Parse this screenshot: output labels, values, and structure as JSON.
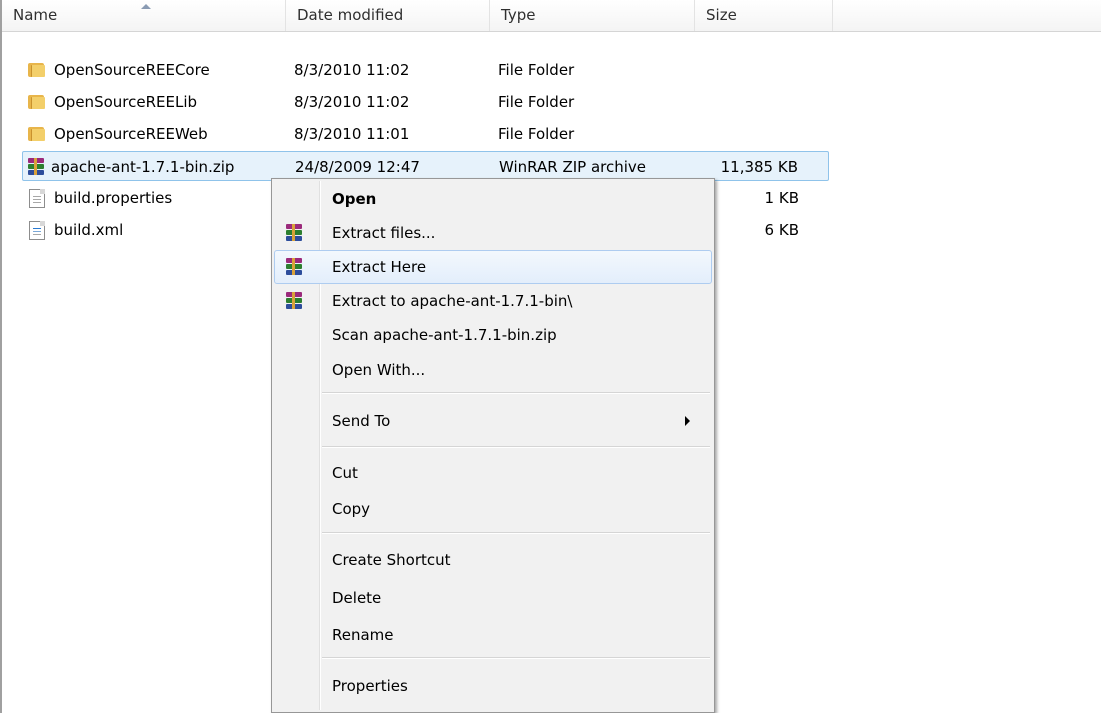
{
  "header": {
    "columns": [
      "Name",
      "Date modified",
      "Type",
      "Size"
    ]
  },
  "files": [
    {
      "name": "OpenSourceREECore",
      "date": "8/3/2010 11:02",
      "type": "File Folder",
      "size": "",
      "icon": "folder-icon"
    },
    {
      "name": "OpenSourceREELib",
      "date": "8/3/2010 11:02",
      "type": "File Folder",
      "size": "",
      "icon": "folder-icon"
    },
    {
      "name": "OpenSourceREEWeb",
      "date": "8/3/2010 11:01",
      "type": "File Folder",
      "size": "",
      "icon": "folder-icon"
    },
    {
      "name": "apache-ant-1.7.1-bin.zip",
      "date": "24/8/2009 12:47",
      "type": "WinRAR ZIP archive",
      "size": "11,385 KB",
      "icon": "winrar-archive-icon",
      "selected": true
    },
    {
      "name": "build.properties",
      "date": "",
      "type": "",
      "size": "1 KB",
      "icon": "properties-file-icon"
    },
    {
      "name": "build.xml",
      "date": "",
      "type": "",
      "size": "6 KB",
      "icon": "xml-file-icon"
    }
  ],
  "context_menu": {
    "items": [
      {
        "label": "Open",
        "bold": true
      },
      {
        "label": "Extract files...",
        "icon": "winrar-icon"
      },
      {
        "label": "Extract Here",
        "icon": "winrar-icon",
        "hover": true
      },
      {
        "label": "Extract to apache-ant-1.7.1-bin\\",
        "icon": "winrar-icon"
      },
      {
        "label": "Scan apache-ant-1.7.1-bin.zip"
      },
      {
        "label": "Open With..."
      },
      {
        "label": "Send To",
        "submenu": true
      },
      {
        "label": "Cut"
      },
      {
        "label": "Copy"
      },
      {
        "label": "Create Shortcut"
      },
      {
        "label": "Delete"
      },
      {
        "label": "Rename"
      },
      {
        "label": "Properties"
      }
    ]
  },
  "colors": {
    "selection_fill": "#e6f2fb",
    "selection_border": "#8fc3ea",
    "menu_background": "#f1f1f1",
    "menu_hover_border": "#aeccf0"
  }
}
